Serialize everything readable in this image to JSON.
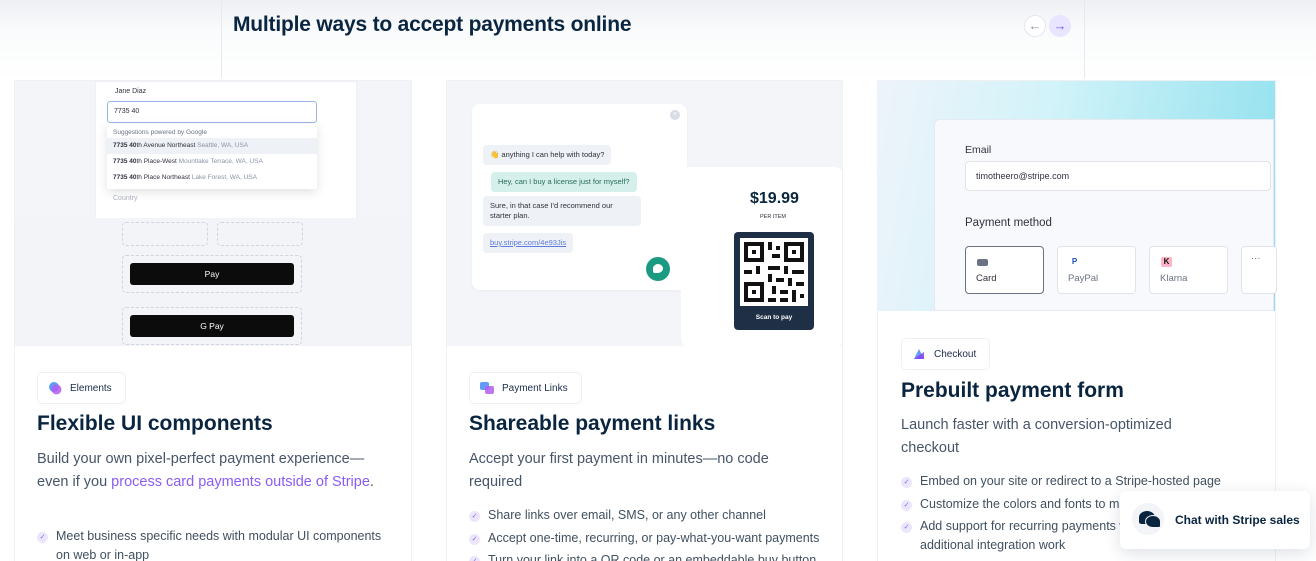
{
  "section": {
    "title": "Multiple ways to accept payments online"
  },
  "nav": {
    "prev_glyph": "←",
    "next_glyph": "→"
  },
  "colors": {
    "accent": "#8a5cf6",
    "heading": "#0a2540",
    "body": "#475569",
    "teal": "#1b9a82"
  },
  "cards": [
    {
      "badge_label": "Elements",
      "badge_icon": "elements-logo-icon",
      "title": "Flexible UI components",
      "desc_pre": "Build your own pixel-perfect payment experience—even if you ",
      "desc_link": "process card payments outside of Stripe",
      "desc_post": ".",
      "bullets": [
        "Meet business specific needs with modular UI components on web or in-app"
      ],
      "demo": {
        "name": "Jane Diaz",
        "address_input": "7735 40",
        "suggestions_header": "Suggestions powered by Google",
        "suggestions": [
          {
            "bold": "7735 40",
            "text": "th Avenue Northeast",
            "dim": "Seattle, WA, USA"
          },
          {
            "bold": "7735 40",
            "text": "th Place-West",
            "dim": "Mountlake Terrace, WA, USA"
          },
          {
            "bold": "7735 40",
            "text": "th Place Northeast",
            "dim": "Lake Forest, WA, USA"
          }
        ],
        "country_label": "Country",
        "apple_pay": " Pay",
        "google_pay": "G Pay"
      }
    },
    {
      "badge_label": "Payment Links",
      "badge_icon": "payment-links-logo-icon",
      "title": "Shareable payment links",
      "desc": "Accept your first payment in minutes—no code required",
      "bullets": [
        "Share links over email, SMS, or any other channel",
        "Accept one-time, recurring, or pay-what-you-want payments",
        "Turn your link into a QR code or an embeddable buy button"
      ],
      "demo": {
        "chat": [
          {
            "role": "bot",
            "text": "👋 anything I can help with today?"
          },
          {
            "role": "user",
            "text": "Hey, can I buy a license just for myself?"
          },
          {
            "role": "bot",
            "text": "Sure, in that case I'd recommend our starter plan."
          },
          {
            "role": "bot",
            "text": "buy.stripe.com/4e93Jis"
          }
        ],
        "price": "$19.99",
        "per_item": "PER ITEM",
        "scan_label": "Scan to pay"
      }
    },
    {
      "badge_label": "Checkout",
      "badge_icon": "checkout-logo-icon",
      "title": "Prebuilt payment form",
      "desc": "Launch faster with a conversion-optimized checkout",
      "bullets": [
        "Embed on your site or redirect to a Stripe-hosted page",
        "Customize the colors and fonts to match your brand",
        "Add support for recurring payments without any additional integration work"
      ],
      "demo": {
        "email_label": "Email",
        "email_value": "timotheero@stripe.com",
        "payment_method_label": "Payment method",
        "methods": [
          "Card",
          "PayPal",
          "Klarna"
        ],
        "more": "···"
      }
    }
  ],
  "chat_widget": {
    "label": "Chat with Stripe sales",
    "icon": "chat-bubbles-icon"
  }
}
